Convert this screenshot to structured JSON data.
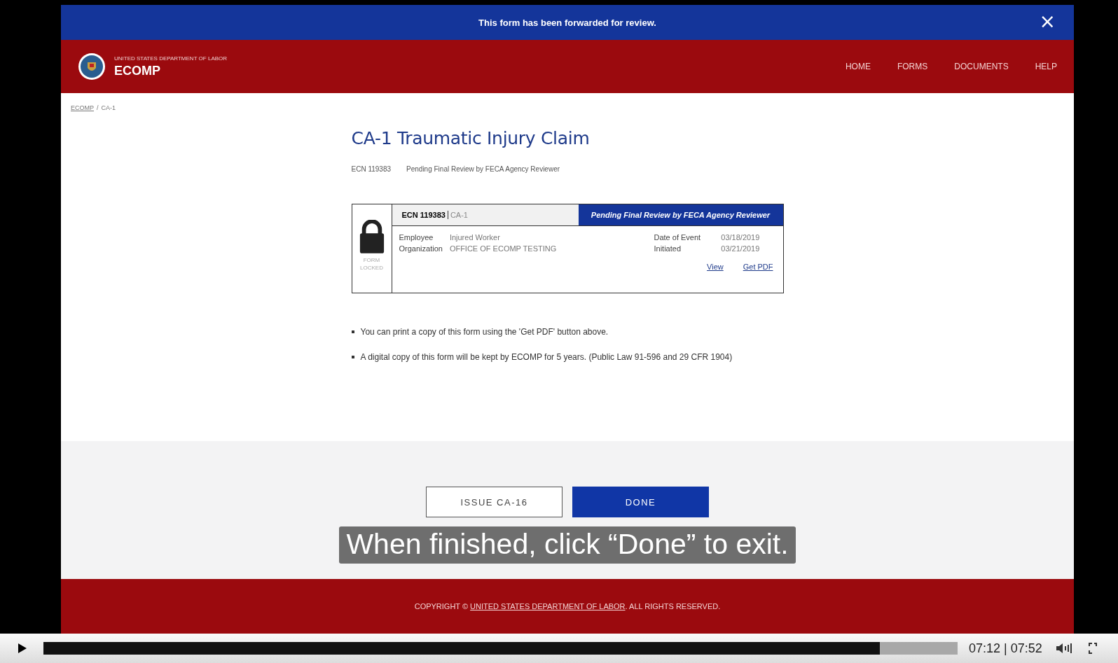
{
  "banner": {
    "message": "This form has been forwarded for review.",
    "close": "×"
  },
  "header": {
    "agency": "UNITED STATES DEPARTMENT OF LABOR",
    "app_name": "ECOMP",
    "nav": [
      "HOME",
      "FORMS",
      "DOCUMENTS",
      "HELP"
    ]
  },
  "breadcrumb": {
    "items": [
      {
        "label": "ECOMP",
        "link": true
      },
      {
        "label": "CA-1",
        "link": false
      }
    ],
    "separator": "/"
  },
  "page": {
    "title": "CA-1 Traumatic Injury Claim",
    "ecn": "ECN 119383",
    "status": "Pending Final Review by FECA Agency Reviewer"
  },
  "card": {
    "ecn": "ECN 119383",
    "form": "CA-1",
    "status": "Pending Final Review by FECA Agency Reviewer",
    "lock_label": [
      "FORM",
      "LOCKED"
    ],
    "fields_left": [
      {
        "label": "Employee",
        "value": "Injured Worker"
      },
      {
        "label": "Organization",
        "value": "OFFICE OF ECOMP TESTING"
      }
    ],
    "fields_right": [
      {
        "label": "Date of Event",
        "value": "03/18/2019"
      },
      {
        "label": "Initiated",
        "value": "03/21/2019"
      }
    ],
    "links": [
      "View",
      "Get PDF"
    ]
  },
  "notes": [
    "You can print a copy of this form using the 'Get PDF' button above.",
    "A digital copy of this form will be kept by ECOMP for 5 years. (Public Law 91-596 and 29 CFR 1904)"
  ],
  "buttons": [
    {
      "label": "ISSUE CA-16",
      "kind": "secondary"
    },
    {
      "label": "DONE",
      "kind": "primary"
    }
  ],
  "caption": "When finished, click “Done” to exit.",
  "footer": {
    "prefix": "COPYRIGHT ©",
    "link": "UNITED STATES DEPARTMENT OF LABOR",
    "suffix": ". ALL RIGHTS RESERVED."
  },
  "player": {
    "level": 0.915,
    "time": "07:12 | 07:52"
  }
}
